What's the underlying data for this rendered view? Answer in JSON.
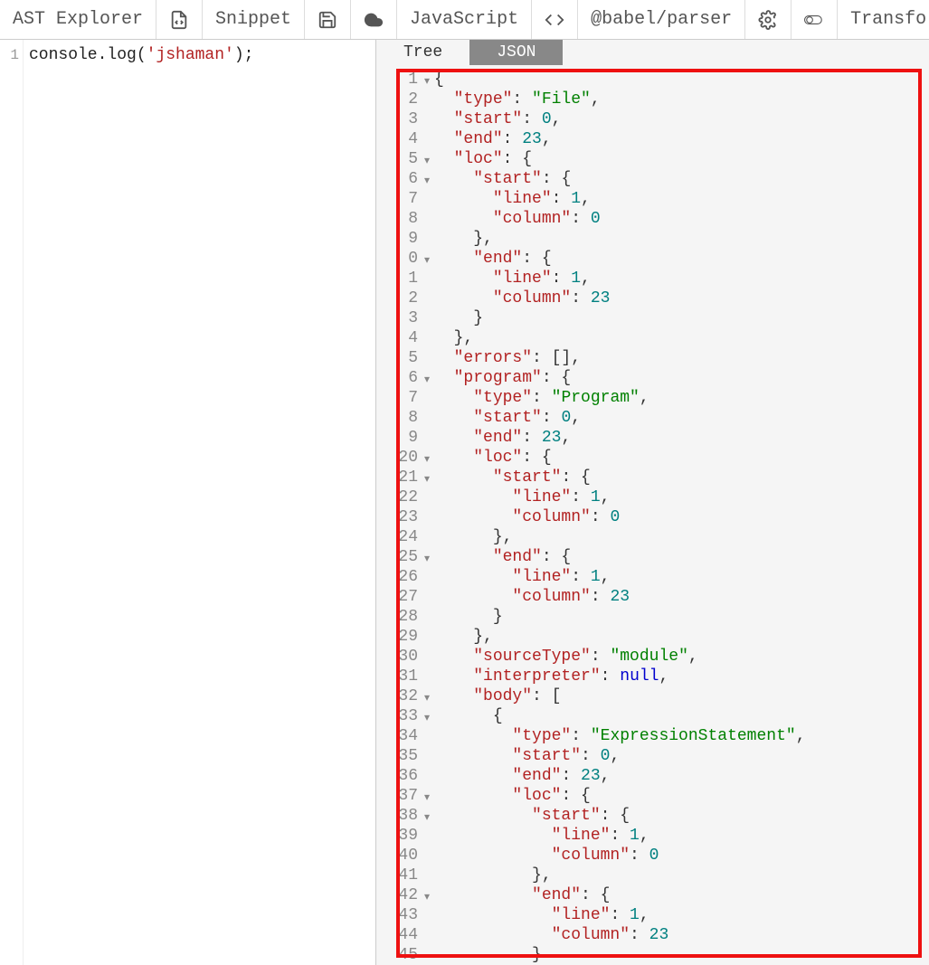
{
  "toolbar": {
    "title": "AST Explorer",
    "snippet_label": "Snippet",
    "language_label": "JavaScript",
    "parser_label": "@babel/parser",
    "transform_label": "Transfo"
  },
  "left_editor": {
    "line_numbers": [
      "1"
    ],
    "code_parts": {
      "prefix": "console.log(",
      "string": "'jshaman'",
      "suffix": ");"
    }
  },
  "right_panel": {
    "tabs": {
      "tree": "Tree",
      "json": "JSON",
      "active": "json"
    },
    "json_lines": [
      {
        "n": "1",
        "c": true,
        "tokens": [
          {
            "t": "punc",
            "v": "{"
          }
        ]
      },
      {
        "n": "2",
        "tokens": [
          {
            "t": "pad",
            "v": "  "
          },
          {
            "t": "key",
            "v": "\"type\""
          },
          {
            "t": "punc",
            "v": ": "
          },
          {
            "t": "str",
            "v": "\"File\""
          },
          {
            "t": "punc",
            "v": ","
          }
        ]
      },
      {
        "n": "3",
        "tokens": [
          {
            "t": "pad",
            "v": "  "
          },
          {
            "t": "key",
            "v": "\"start\""
          },
          {
            "t": "punc",
            "v": ": "
          },
          {
            "t": "num",
            "v": "0"
          },
          {
            "t": "punc",
            "v": ","
          }
        ]
      },
      {
        "n": "4",
        "tokens": [
          {
            "t": "pad",
            "v": "  "
          },
          {
            "t": "key",
            "v": "\"end\""
          },
          {
            "t": "punc",
            "v": ": "
          },
          {
            "t": "num",
            "v": "23"
          },
          {
            "t": "punc",
            "v": ","
          }
        ]
      },
      {
        "n": "5",
        "c": true,
        "tokens": [
          {
            "t": "pad",
            "v": "  "
          },
          {
            "t": "key",
            "v": "\"loc\""
          },
          {
            "t": "punc",
            "v": ": {"
          }
        ]
      },
      {
        "n": "6",
        "c": true,
        "tokens": [
          {
            "t": "pad",
            "v": "    "
          },
          {
            "t": "key",
            "v": "\"start\""
          },
          {
            "t": "punc",
            "v": ": {"
          }
        ]
      },
      {
        "n": "7",
        "tokens": [
          {
            "t": "pad",
            "v": "      "
          },
          {
            "t": "key",
            "v": "\"line\""
          },
          {
            "t": "punc",
            "v": ": "
          },
          {
            "t": "num",
            "v": "1"
          },
          {
            "t": "punc",
            "v": ","
          }
        ]
      },
      {
        "n": "8",
        "tokens": [
          {
            "t": "pad",
            "v": "      "
          },
          {
            "t": "key",
            "v": "\"column\""
          },
          {
            "t": "punc",
            "v": ": "
          },
          {
            "t": "num",
            "v": "0"
          }
        ]
      },
      {
        "n": "9",
        "tokens": [
          {
            "t": "pad",
            "v": "    "
          },
          {
            "t": "punc",
            "v": "},"
          }
        ]
      },
      {
        "n": "0",
        "c": true,
        "tokens": [
          {
            "t": "pad",
            "v": "    "
          },
          {
            "t": "key",
            "v": "\"end\""
          },
          {
            "t": "punc",
            "v": ": {"
          }
        ]
      },
      {
        "n": "1",
        "tokens": [
          {
            "t": "pad",
            "v": "      "
          },
          {
            "t": "key",
            "v": "\"line\""
          },
          {
            "t": "punc",
            "v": ": "
          },
          {
            "t": "num",
            "v": "1"
          },
          {
            "t": "punc",
            "v": ","
          }
        ]
      },
      {
        "n": "2",
        "tokens": [
          {
            "t": "pad",
            "v": "      "
          },
          {
            "t": "key",
            "v": "\"column\""
          },
          {
            "t": "punc",
            "v": ": "
          },
          {
            "t": "num",
            "v": "23"
          }
        ]
      },
      {
        "n": "3",
        "tokens": [
          {
            "t": "pad",
            "v": "    "
          },
          {
            "t": "punc",
            "v": "}"
          }
        ]
      },
      {
        "n": "4",
        "tokens": [
          {
            "t": "pad",
            "v": "  "
          },
          {
            "t": "punc",
            "v": "},"
          }
        ]
      },
      {
        "n": "5",
        "tokens": [
          {
            "t": "pad",
            "v": "  "
          },
          {
            "t": "key",
            "v": "\"errors\""
          },
          {
            "t": "punc",
            "v": ": [],"
          }
        ]
      },
      {
        "n": "6",
        "c": true,
        "tokens": [
          {
            "t": "pad",
            "v": "  "
          },
          {
            "t": "key",
            "v": "\"program\""
          },
          {
            "t": "punc",
            "v": ": {"
          }
        ]
      },
      {
        "n": "7",
        "tokens": [
          {
            "t": "pad",
            "v": "    "
          },
          {
            "t": "key",
            "v": "\"type\""
          },
          {
            "t": "punc",
            "v": ": "
          },
          {
            "t": "str",
            "v": "\"Program\""
          },
          {
            "t": "punc",
            "v": ","
          }
        ]
      },
      {
        "n": "8",
        "tokens": [
          {
            "t": "pad",
            "v": "    "
          },
          {
            "t": "key",
            "v": "\"start\""
          },
          {
            "t": "punc",
            "v": ": "
          },
          {
            "t": "num",
            "v": "0"
          },
          {
            "t": "punc",
            "v": ","
          }
        ]
      },
      {
        "n": "9",
        "tokens": [
          {
            "t": "pad",
            "v": "    "
          },
          {
            "t": "key",
            "v": "\"end\""
          },
          {
            "t": "punc",
            "v": ": "
          },
          {
            "t": "num",
            "v": "23"
          },
          {
            "t": "punc",
            "v": ","
          }
        ]
      },
      {
        "n": "20",
        "c": true,
        "tokens": [
          {
            "t": "pad",
            "v": "    "
          },
          {
            "t": "key",
            "v": "\"loc\""
          },
          {
            "t": "punc",
            "v": ": {"
          }
        ]
      },
      {
        "n": "21",
        "c": true,
        "tokens": [
          {
            "t": "pad",
            "v": "      "
          },
          {
            "t": "key",
            "v": "\"start\""
          },
          {
            "t": "punc",
            "v": ": {"
          }
        ]
      },
      {
        "n": "22",
        "tokens": [
          {
            "t": "pad",
            "v": "        "
          },
          {
            "t": "key",
            "v": "\"line\""
          },
          {
            "t": "punc",
            "v": ": "
          },
          {
            "t": "num",
            "v": "1"
          },
          {
            "t": "punc",
            "v": ","
          }
        ]
      },
      {
        "n": "23",
        "tokens": [
          {
            "t": "pad",
            "v": "        "
          },
          {
            "t": "key",
            "v": "\"column\""
          },
          {
            "t": "punc",
            "v": ": "
          },
          {
            "t": "num",
            "v": "0"
          }
        ]
      },
      {
        "n": "24",
        "tokens": [
          {
            "t": "pad",
            "v": "      "
          },
          {
            "t": "punc",
            "v": "},"
          }
        ]
      },
      {
        "n": "25",
        "c": true,
        "tokens": [
          {
            "t": "pad",
            "v": "      "
          },
          {
            "t": "key",
            "v": "\"end\""
          },
          {
            "t": "punc",
            "v": ": {"
          }
        ]
      },
      {
        "n": "26",
        "tokens": [
          {
            "t": "pad",
            "v": "        "
          },
          {
            "t": "key",
            "v": "\"line\""
          },
          {
            "t": "punc",
            "v": ": "
          },
          {
            "t": "num",
            "v": "1"
          },
          {
            "t": "punc",
            "v": ","
          }
        ]
      },
      {
        "n": "27",
        "tokens": [
          {
            "t": "pad",
            "v": "        "
          },
          {
            "t": "key",
            "v": "\"column\""
          },
          {
            "t": "punc",
            "v": ": "
          },
          {
            "t": "num",
            "v": "23"
          }
        ]
      },
      {
        "n": "28",
        "tokens": [
          {
            "t": "pad",
            "v": "      "
          },
          {
            "t": "punc",
            "v": "}"
          }
        ]
      },
      {
        "n": "29",
        "tokens": [
          {
            "t": "pad",
            "v": "    "
          },
          {
            "t": "punc",
            "v": "},"
          }
        ]
      },
      {
        "n": "30",
        "tokens": [
          {
            "t": "pad",
            "v": "    "
          },
          {
            "t": "key",
            "v": "\"sourceType\""
          },
          {
            "t": "punc",
            "v": ": "
          },
          {
            "t": "str",
            "v": "\"module\""
          },
          {
            "t": "punc",
            "v": ","
          }
        ]
      },
      {
        "n": "31",
        "tokens": [
          {
            "t": "pad",
            "v": "    "
          },
          {
            "t": "key",
            "v": "\"interpreter\""
          },
          {
            "t": "punc",
            "v": ": "
          },
          {
            "t": "null",
            "v": "null"
          },
          {
            "t": "punc",
            "v": ","
          }
        ]
      },
      {
        "n": "32",
        "c": true,
        "tokens": [
          {
            "t": "pad",
            "v": "    "
          },
          {
            "t": "key",
            "v": "\"body\""
          },
          {
            "t": "punc",
            "v": ": ["
          }
        ]
      },
      {
        "n": "33",
        "c": true,
        "tokens": [
          {
            "t": "pad",
            "v": "      "
          },
          {
            "t": "punc",
            "v": "{"
          }
        ]
      },
      {
        "n": "34",
        "tokens": [
          {
            "t": "pad",
            "v": "        "
          },
          {
            "t": "key",
            "v": "\"type\""
          },
          {
            "t": "punc",
            "v": ": "
          },
          {
            "t": "str",
            "v": "\"ExpressionStatement\""
          },
          {
            "t": "punc",
            "v": ","
          }
        ]
      },
      {
        "n": "35",
        "tokens": [
          {
            "t": "pad",
            "v": "        "
          },
          {
            "t": "key",
            "v": "\"start\""
          },
          {
            "t": "punc",
            "v": ": "
          },
          {
            "t": "num",
            "v": "0"
          },
          {
            "t": "punc",
            "v": ","
          }
        ]
      },
      {
        "n": "36",
        "tokens": [
          {
            "t": "pad",
            "v": "        "
          },
          {
            "t": "key",
            "v": "\"end\""
          },
          {
            "t": "punc",
            "v": ": "
          },
          {
            "t": "num",
            "v": "23"
          },
          {
            "t": "punc",
            "v": ","
          }
        ]
      },
      {
        "n": "37",
        "c": true,
        "tokens": [
          {
            "t": "pad",
            "v": "        "
          },
          {
            "t": "key",
            "v": "\"loc\""
          },
          {
            "t": "punc",
            "v": ": {"
          }
        ]
      },
      {
        "n": "38",
        "c": true,
        "tokens": [
          {
            "t": "pad",
            "v": "          "
          },
          {
            "t": "key",
            "v": "\"start\""
          },
          {
            "t": "punc",
            "v": ": {"
          }
        ]
      },
      {
        "n": "39",
        "tokens": [
          {
            "t": "pad",
            "v": "            "
          },
          {
            "t": "key",
            "v": "\"line\""
          },
          {
            "t": "punc",
            "v": ": "
          },
          {
            "t": "num",
            "v": "1"
          },
          {
            "t": "punc",
            "v": ","
          }
        ]
      },
      {
        "n": "40",
        "tokens": [
          {
            "t": "pad",
            "v": "            "
          },
          {
            "t": "key",
            "v": "\"column\""
          },
          {
            "t": "punc",
            "v": ": "
          },
          {
            "t": "num",
            "v": "0"
          }
        ]
      },
      {
        "n": "41",
        "tokens": [
          {
            "t": "pad",
            "v": "          "
          },
          {
            "t": "punc",
            "v": "},"
          }
        ]
      },
      {
        "n": "42",
        "c": true,
        "tokens": [
          {
            "t": "pad",
            "v": "          "
          },
          {
            "t": "key",
            "v": "\"end\""
          },
          {
            "t": "punc",
            "v": ": {"
          }
        ]
      },
      {
        "n": "43",
        "tokens": [
          {
            "t": "pad",
            "v": "            "
          },
          {
            "t": "key",
            "v": "\"line\""
          },
          {
            "t": "punc",
            "v": ": "
          },
          {
            "t": "num",
            "v": "1"
          },
          {
            "t": "punc",
            "v": ","
          }
        ]
      },
      {
        "n": "44",
        "tokens": [
          {
            "t": "pad",
            "v": "            "
          },
          {
            "t": "key",
            "v": "\"column\""
          },
          {
            "t": "punc",
            "v": ": "
          },
          {
            "t": "num",
            "v": "23"
          }
        ]
      },
      {
        "n": "45",
        "tokens": [
          {
            "t": "pad",
            "v": "          "
          },
          {
            "t": "punc",
            "v": "}"
          }
        ]
      }
    ]
  }
}
